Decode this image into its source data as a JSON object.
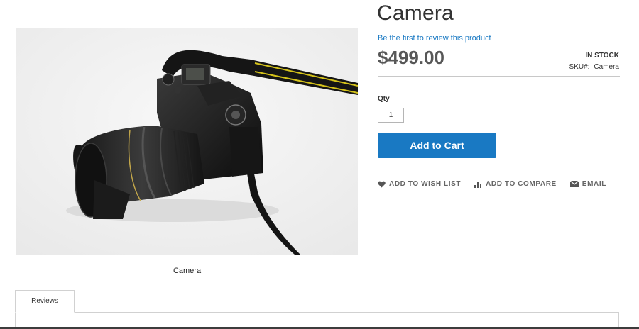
{
  "product": {
    "title": "Camera",
    "review_link": "Be the first to review this product",
    "price": "$499.00",
    "stock": "IN STOCK",
    "sku_label": "SKU#:",
    "sku_value": "Camera"
  },
  "gallery": {
    "caption": "Camera",
    "image_subject": "dslr-camera-photo"
  },
  "purchase": {
    "qty_label": "Qty",
    "qty_value": "1",
    "add_to_cart_label": "Add to Cart"
  },
  "actions": {
    "wishlist_label": "ADD TO WISH LIST",
    "compare_label": "ADD TO COMPARE",
    "email_label": "EMAIL"
  },
  "tabs": [
    {
      "label": "Reviews"
    }
  ],
  "colors": {
    "accent": "#1979c3",
    "price": "#575757",
    "action_text": "#666666"
  },
  "icons": {
    "wishlist": "heart-icon",
    "compare": "bar-chart-icon",
    "email": "envelope-icon"
  }
}
